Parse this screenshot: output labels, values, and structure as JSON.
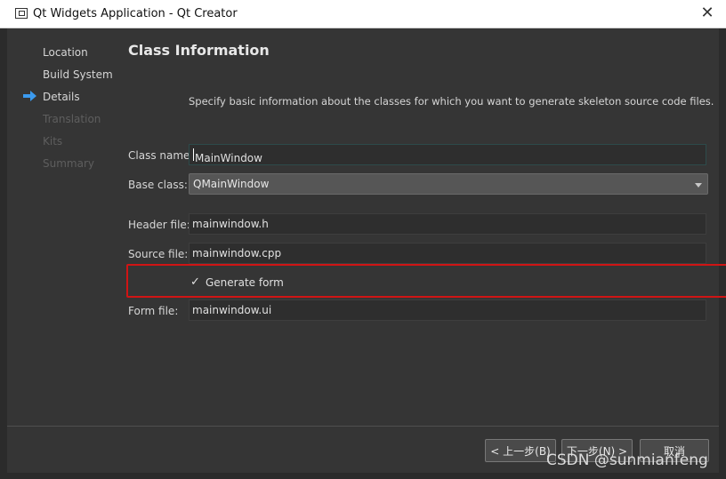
{
  "window": {
    "title": "Qt Widgets Application - Qt Creator",
    "close_symbol": "✕"
  },
  "sidebar": {
    "steps": [
      {
        "label": "Location",
        "state": "done"
      },
      {
        "label": "Build System",
        "state": "done"
      },
      {
        "label": "Details",
        "state": "current"
      },
      {
        "label": "Translation",
        "state": "pending"
      },
      {
        "label": "Kits",
        "state": "pending"
      },
      {
        "label": "Summary",
        "state": "pending"
      }
    ],
    "current_icon": "right-arrow-icon"
  },
  "page": {
    "title": "Class Information",
    "description": "Specify basic information about the classes for which you want to generate skeleton source code files."
  },
  "form": {
    "class_name": {
      "label": "Class name:",
      "value": "MainWindow"
    },
    "base_class": {
      "label": "Base class:",
      "value": "QMainWindow"
    },
    "header_file": {
      "label": "Header file:",
      "value": "mainwindow.h"
    },
    "source_file": {
      "label": "Source file:",
      "value": "mainwindow.cpp"
    },
    "generate_form": {
      "label": "Generate form",
      "checked": true,
      "mark": "✓"
    },
    "form_file": {
      "label": "Form file:",
      "value": "mainwindow.ui"
    }
  },
  "buttons": {
    "back": "< 上一步(B)",
    "next": "下一步(N) >",
    "cancel": "取消"
  },
  "watermark": "CSDN @sunmianfeng",
  "colors": {
    "accent": "#3b9aee",
    "highlight_box": "#d01414"
  }
}
